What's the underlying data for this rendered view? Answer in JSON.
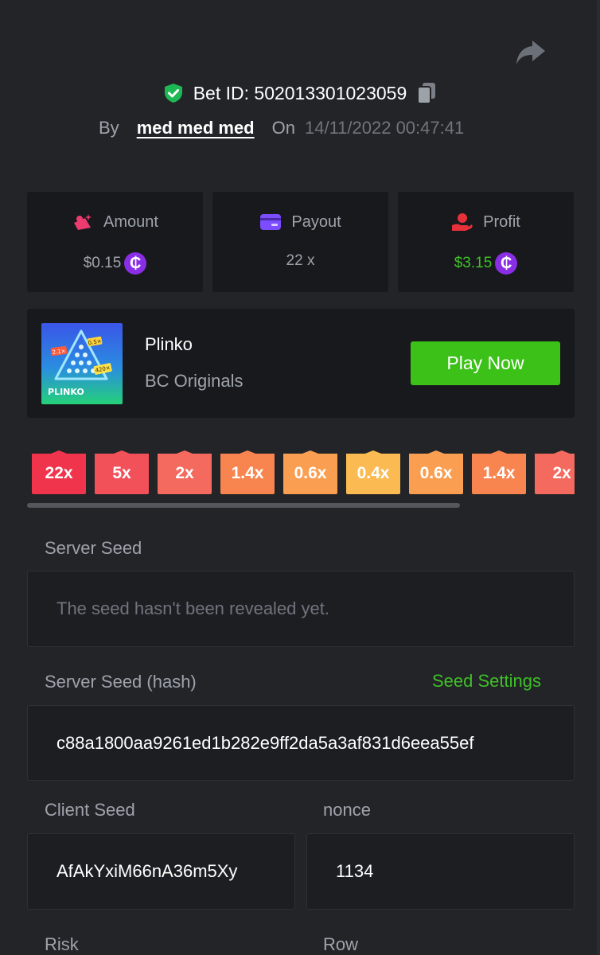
{
  "header": {
    "bet_id_label": "Bet ID: 502013301023059",
    "by_label": "By",
    "username": "med med med",
    "on_label": "On",
    "date": "14/11/2022 00:47:41"
  },
  "stats": {
    "amount": {
      "label": "Amount",
      "value": "$0.15",
      "icon": "money-bag-icon"
    },
    "payout": {
      "label": "Payout",
      "value": "22 x",
      "icon": "card-icon"
    },
    "profit": {
      "label": "Profit",
      "value": "$3.15",
      "icon": "hand-coin-icon"
    },
    "coin_symbol": "₵"
  },
  "game": {
    "name": "Plinko",
    "provider": "BC Originals",
    "play_label": "Play Now",
    "thumb": {
      "title": "PLINKO",
      "tags": [
        "2.1×",
        "0.5×",
        "420×"
      ]
    }
  },
  "multipliers": [
    {
      "label": "22x",
      "color": "#f0344c"
    },
    {
      "label": "5x",
      "color": "#f2515a"
    },
    {
      "label": "2x",
      "color": "#f46a5e"
    },
    {
      "label": "1.4x",
      "color": "#f8854f"
    },
    {
      "label": "0.6x",
      "color": "#fa9f52"
    },
    {
      "label": "0.4x",
      "color": "#fcbb52"
    },
    {
      "label": "0.6x",
      "color": "#fa9f52"
    },
    {
      "label": "1.4x",
      "color": "#f8854f"
    },
    {
      "label": "2x",
      "color": "#f46a5e"
    }
  ],
  "server_seed": {
    "label": "Server Seed",
    "value": "The seed hasn't been revealed yet."
  },
  "server_seed_hash": {
    "label": "Server Seed (hash)",
    "settings_link": "Seed Settings",
    "value": "c88a1800aa9261ed1b282e9ff2da5a3af831d6eea55ef"
  },
  "client_seed": {
    "label": "Client Seed",
    "value": "AfAkYxiM66nA36m5Xy"
  },
  "nonce": {
    "label": "nonce",
    "value": "1134"
  },
  "risk": {
    "label": "Risk"
  },
  "row": {
    "label": "Row"
  },
  "colors": {
    "background": "#232428",
    "panel": "#18191c",
    "accent_green": "#3bc117",
    "coin_purple": "#8a2ee5"
  }
}
